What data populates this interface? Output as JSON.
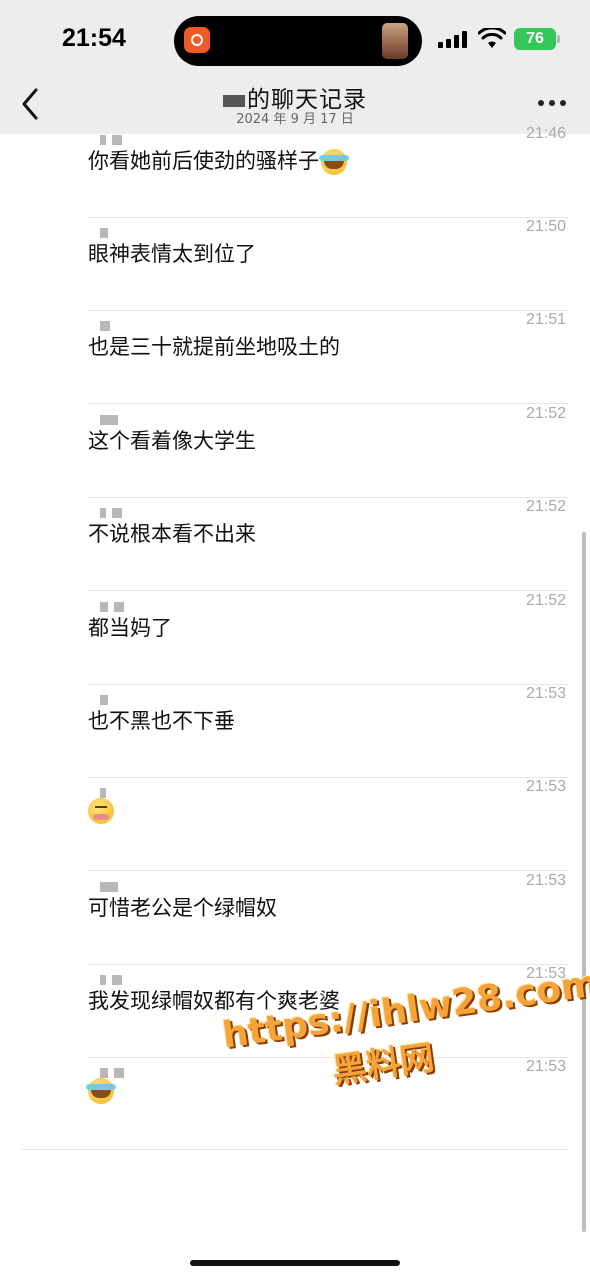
{
  "status_bar": {
    "time": "21:54",
    "battery": "76",
    "battery_color": "#34c759"
  },
  "header": {
    "title": "的聊天记录",
    "subtitle": "2024 年 9 月 17 日",
    "back_icon": "chevron-left-icon",
    "more_icon": "more-dots-icon"
  },
  "messages": [
    {
      "time": "21:46",
      "text": "你看她前后使劲的骚样子",
      "emoji": "laugh-cry"
    },
    {
      "time": "21:50",
      "text": "眼神表情太到位了",
      "emoji": ""
    },
    {
      "time": "21:51",
      "text": "也是三十就提前坐地吸土的",
      "emoji": ""
    },
    {
      "time": "21:52",
      "text": "这个看着像大学生",
      "emoji": ""
    },
    {
      "time": "21:52",
      "text": "不说根本看不出来",
      "emoji": ""
    },
    {
      "time": "21:52",
      "text": "都当妈了",
      "emoji": ""
    },
    {
      "time": "21:53",
      "text": "也不黑也不下垂",
      "emoji": ""
    },
    {
      "time": "21:53",
      "text": "",
      "emoji": "blush"
    },
    {
      "time": "21:53",
      "text": "可惜老公是个绿帽奴",
      "emoji": ""
    },
    {
      "time": "21:53",
      "text": "我发现绿帽奴都有个爽老婆",
      "emoji": ""
    },
    {
      "time": "21:53",
      "text": "",
      "emoji": "laugh-cry"
    }
  ],
  "watermark": {
    "url": "https://ihlw28.com",
    "name": "黑料网"
  }
}
